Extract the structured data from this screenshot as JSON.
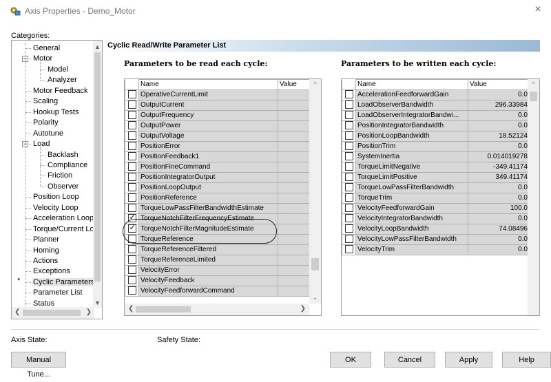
{
  "window": {
    "title": "Axis Properties - Demo_Motor",
    "close_glyph": "×"
  },
  "categories": {
    "label": "Categories:",
    "items": [
      {
        "label": "General"
      },
      {
        "label": "Motor",
        "toggle": "−"
      },
      {
        "label": "Model"
      },
      {
        "label": "Analyzer"
      },
      {
        "label": "Motor Feedback"
      },
      {
        "label": "Scaling"
      },
      {
        "label": "Hookup Tests"
      },
      {
        "label": "Polarity"
      },
      {
        "label": "Autotune"
      },
      {
        "label": "Load",
        "toggle": "−"
      },
      {
        "label": "Backlash"
      },
      {
        "label": "Compliance"
      },
      {
        "label": "Friction"
      },
      {
        "label": "Observer"
      },
      {
        "label": "Position Loop"
      },
      {
        "label": "Velocity Loop"
      },
      {
        "label": "Acceleration Loop"
      },
      {
        "label": "Torque/Current Lo"
      },
      {
        "label": "Planner"
      },
      {
        "label": "Homing"
      },
      {
        "label": "Actions"
      },
      {
        "label": "Exceptions"
      },
      {
        "label": "Cyclic Parameters",
        "marker": "*"
      },
      {
        "label": "Parameter List"
      },
      {
        "label": "Status"
      }
    ]
  },
  "section": {
    "title": "Cyclic Read/Write Parameter List",
    "read_title": "Parameters to be read each cycle:",
    "write_title": "Parameters to be written each cycle:"
  },
  "read_grid": {
    "columns": {
      "name": "Name",
      "value": "Value"
    },
    "rows": [
      {
        "name": "OperativeCurrentLimit",
        "checked": false
      },
      {
        "name": "OutputCurrent",
        "checked": false
      },
      {
        "name": "OutputFrequency",
        "checked": false
      },
      {
        "name": "OutputPower",
        "checked": false
      },
      {
        "name": "OutputVoltage",
        "checked": false
      },
      {
        "name": "PositionError",
        "checked": false
      },
      {
        "name": "PositionFeedback1",
        "checked": false
      },
      {
        "name": "PositionFineCommand",
        "checked": false
      },
      {
        "name": "PositionIntegratorOutput",
        "checked": false
      },
      {
        "name": "PositionLoopOutput",
        "checked": false
      },
      {
        "name": "PositionReference",
        "checked": false
      },
      {
        "name": "TorqueLowPassFilterBandwidthEstimate",
        "checked": false
      },
      {
        "name": "TorqueNotchFilterFrequencyEstimate",
        "checked": true
      },
      {
        "name": "TorqueNotchFilterMagnitudeEstimate",
        "checked": true
      },
      {
        "name": "TorqueReference",
        "checked": false
      },
      {
        "name": "TorqueReferenceFiltered",
        "checked": false
      },
      {
        "name": "TorqueReferenceLimited",
        "checked": false
      },
      {
        "name": "VelocityError",
        "checked": false
      },
      {
        "name": "VelocityFeedback",
        "checked": false
      },
      {
        "name": "VelocityFeedforwardCommand",
        "checked": false
      }
    ]
  },
  "write_grid": {
    "columns": {
      "name": "Name",
      "value": "Value"
    },
    "rows": [
      {
        "name": "AccelerationFeedforwardGain",
        "value": "0.0",
        "checked": false
      },
      {
        "name": "LoadObserverBandwidth",
        "value": "296.33984",
        "checked": false
      },
      {
        "name": "LoadObserverIntegratorBandwi...",
        "value": "0.0",
        "checked": false
      },
      {
        "name": "PositionIntegratorBandwidth",
        "value": "0.0",
        "checked": false
      },
      {
        "name": "PositionLoopBandwidth",
        "value": "18.52124",
        "checked": false
      },
      {
        "name": "PositionTrim",
        "value": "0.0",
        "checked": false
      },
      {
        "name": "SystemInertia",
        "value": "0.014019278",
        "checked": false
      },
      {
        "name": "TorqueLimitNegative",
        "value": "-349.41174",
        "checked": false
      },
      {
        "name": "TorqueLimitPositive",
        "value": "349.41174",
        "checked": false
      },
      {
        "name": "TorqueLowPassFilterBandwidth",
        "value": "0.0",
        "checked": false
      },
      {
        "name": "TorqueTrim",
        "value": "0.0",
        "checked": false
      },
      {
        "name": "VelocityFeedforwardGain",
        "value": "100.0",
        "checked": false
      },
      {
        "name": "VelocityIntegratorBandwidth",
        "value": "0.0",
        "checked": false
      },
      {
        "name": "VelocityLoopBandwidth",
        "value": "74.08496",
        "checked": false
      },
      {
        "name": "VelocityLowPassFilterBandwidth",
        "value": "0.0",
        "checked": false
      },
      {
        "name": "VelocityTrim",
        "value": "0.0",
        "checked": false
      }
    ]
  },
  "status": {
    "axis_state_label": "Axis State:",
    "safety_state_label": "Safety State:"
  },
  "buttons": {
    "manual_tune": "Manual Tune...",
    "ok": "OK",
    "cancel": "Cancel",
    "apply": "Apply",
    "help": "Help"
  },
  "icons": {
    "scroll_up": "chevron-up-icon",
    "scroll_down": "chevron-down-icon",
    "scroll_left": "chevron-left-icon",
    "scroll_right": "chevron-right-icon"
  },
  "colors": {
    "header_gradient_end": "#9ab9d5",
    "cell_gray": "#d8d8d8",
    "button_face": "#e1e1e1"
  }
}
